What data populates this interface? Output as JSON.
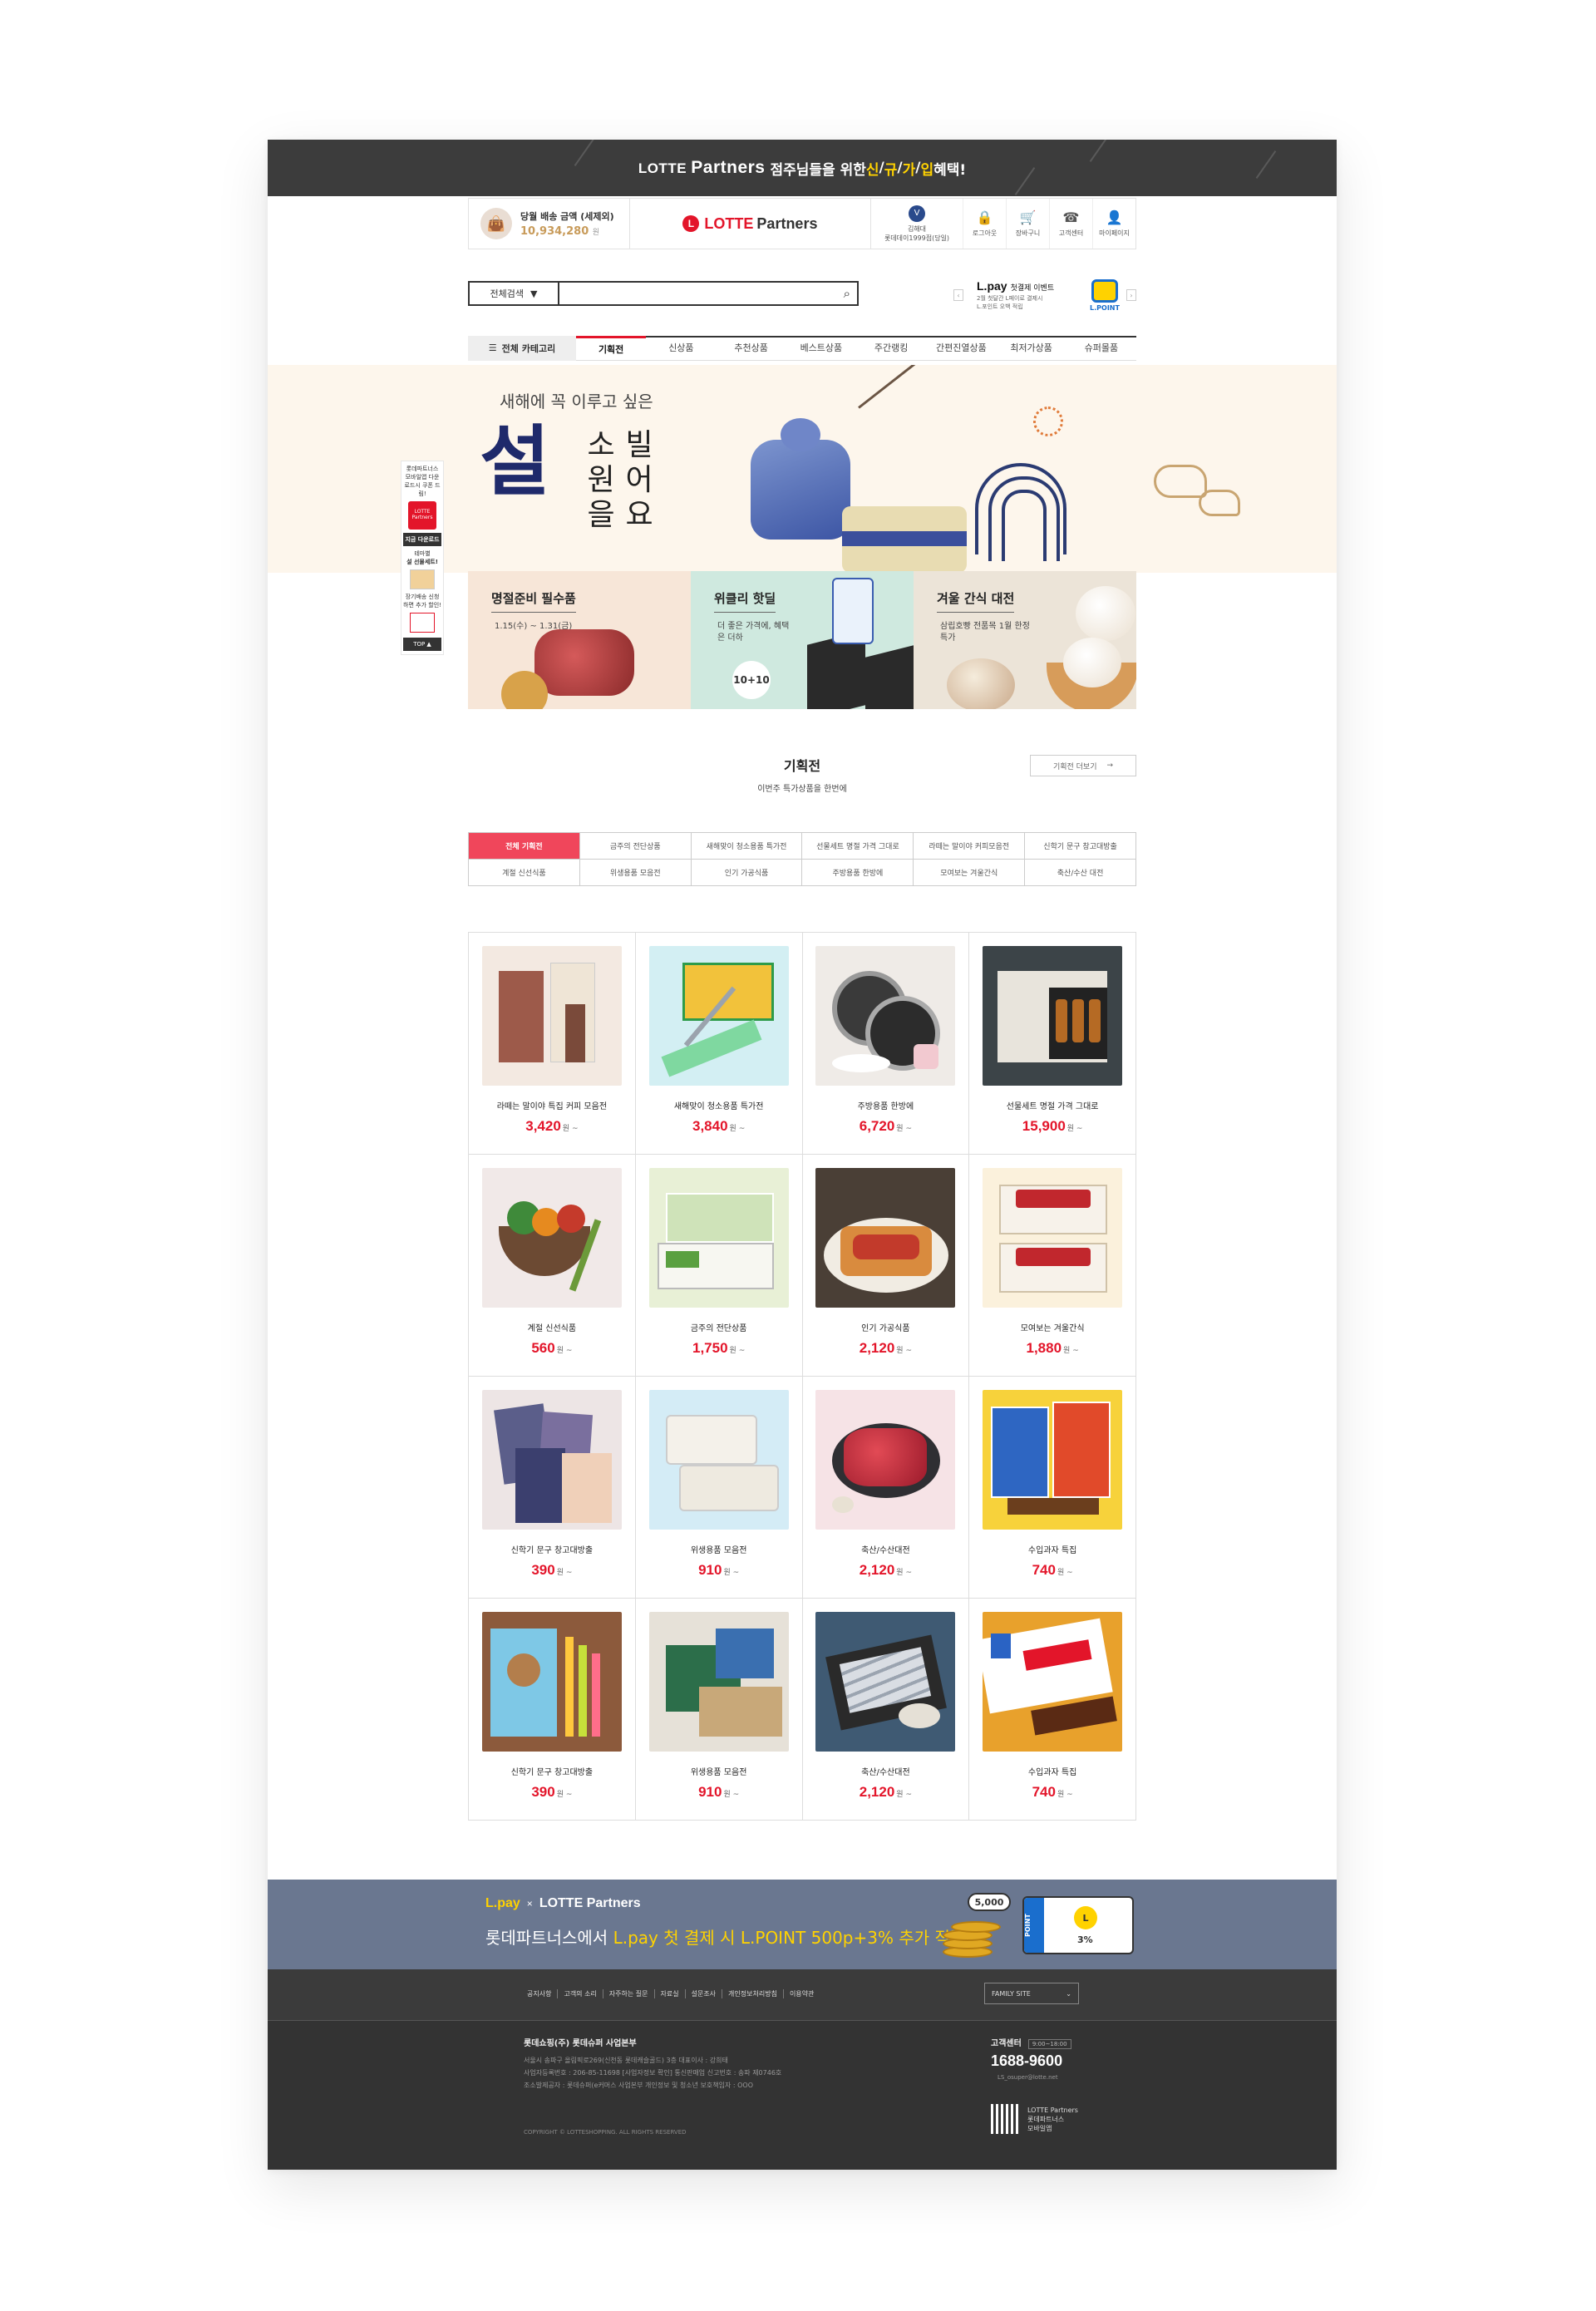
{
  "top_banner": {
    "brand_a": "LOTTE",
    "brand_b": "Partners",
    "text_a": " 점주님들을 위한 ",
    "hl1": "신",
    "sep1": "/",
    "hl2": "규",
    "sep2": "/",
    "hl3": "가",
    "sep3": "/",
    "hl4": "입",
    "text_b": " 혜택!"
  },
  "header": {
    "amount_label": "당월 배송 금액 (세제외)",
    "amount_value": "10,934,280",
    "amount_unit": "원",
    "logo_lotte": "LOTTE",
    "logo_partners": "Partners",
    "user_badge": "V",
    "user_name": "김해대",
    "user_store": "롯데데이1999점(당일)",
    "util": [
      {
        "icon": "lock-icon",
        "glyph": "🔒",
        "label": "로그아웃"
      },
      {
        "icon": "cart-icon",
        "glyph": "🛒",
        "label": "장바구니"
      },
      {
        "icon": "headset-icon",
        "glyph": "☎",
        "label": "고객센터"
      },
      {
        "icon": "person-icon",
        "glyph": "👤",
        "label": "마이페이지"
      }
    ]
  },
  "search": {
    "category": "전체검색",
    "category_arrow": "▼",
    "placeholder": "",
    "icon": "search-icon"
  },
  "lpay_event": {
    "title": "L.pay",
    "subtitle": "첫결제 이벤트",
    "desc": "2월 첫달간 L페이로 결제시 L.포인트 오백 적립",
    "point_label": "L.POINT",
    "prev": "‹",
    "next": "›"
  },
  "gnb": {
    "all_label": "전체 카테고리",
    "all_icon": "☰",
    "items": [
      "기획전",
      "신상품",
      "추천상품",
      "베스트상품",
      "주간랭킹",
      "간편진열상품",
      "최저가상품",
      "슈퍼몰품"
    ]
  },
  "hero": {
    "subtitle": "새해에 꼭 이루고 싶은",
    "big": "설",
    "col1": [
      "소",
      "원",
      "을"
    ],
    "col2": [
      "빌",
      "어",
      "요"
    ]
  },
  "promos": [
    {
      "title": "명절준비 필수품",
      "desc": "1.15(수) ~ 1.31(금)"
    },
    {
      "title": "위클리 핫딜",
      "desc": "더 좋은 가격에, 혜택은 더하",
      "badge": "10+10"
    },
    {
      "title": "겨울 간식 대전",
      "desc": "삼립호빵 전품목 1월 한정 특가"
    }
  ],
  "side_menu": {
    "t1": "롯데파트너스 모바일앱 다운로드시 쿠폰 드림!",
    "logo": "LOTTE Partners",
    "t2": "지금 다운로드",
    "t3": "테마별",
    "t4": "설 선물세트!",
    "t5": "장기배송 신청하면 추가 할인!",
    "top": "TOP ▲"
  },
  "section": {
    "title": "기획전",
    "subtitle": "이번주 특가상품을 한번에",
    "more": "기획전 더보기",
    "more_icon": "→"
  },
  "tabs": [
    "전체 기획전",
    "금주의 전단상품",
    "새해맞이 청소용품 특가전",
    "선물세트 명절 가격 그대로",
    "라떼는 말이야 커피모음전",
    "신학기 문구 창고대방출",
    "계절 신선식품",
    "위생용품 모음전",
    "인기 가공식품",
    "주방용품 한방에",
    "모여보는 겨울간식",
    "축산/수산 대전"
  ],
  "products": [
    {
      "name": "라떼는 말이야 특집 커피 모음전",
      "price": "3,420",
      "unit": "원 ~"
    },
    {
      "name": "새해맞이 청소용품 특가전",
      "price": "3,840",
      "unit": "원 ~"
    },
    {
      "name": "주방용품 한방에",
      "price": "6,720",
      "unit": "원 ~"
    },
    {
      "name": "선물세트 명절 가격 그대로",
      "price": "15,900",
      "unit": "원 ~"
    },
    {
      "name": "계절 신선식품",
      "price": "560",
      "unit": "원 ~"
    },
    {
      "name": "금주의 전단상품",
      "price": "1,750",
      "unit": "원 ~"
    },
    {
      "name": "인기 가공식품",
      "price": "2,120",
      "unit": "원 ~"
    },
    {
      "name": "모여보는 겨울간식",
      "price": "1,880",
      "unit": "원 ~"
    },
    {
      "name": "신학기 문구 창고대방출",
      "price": "390",
      "unit": "원 ~"
    },
    {
      "name": "위생용품 모음전",
      "price": "910",
      "unit": "원 ~"
    },
    {
      "name": "축산/수산대전",
      "price": "2,120",
      "unit": "원 ~"
    },
    {
      "name": "수입과자 특집",
      "price": "740",
      "unit": "원 ~"
    },
    {
      "name": "신학기 문구 창고대방출",
      "price": "390",
      "unit": "원 ~"
    },
    {
      "name": "위생용품 모음전",
      "price": "910",
      "unit": "원 ~"
    },
    {
      "name": "축산/수산대전",
      "price": "2,120",
      "unit": "원 ~"
    },
    {
      "name": "수입과자 특집",
      "price": "740",
      "unit": "원 ~"
    }
  ],
  "lpay_band": {
    "lpay": "L.pay",
    "x": "×",
    "brand": "LOTTE Partners",
    "msg_a": "롯데파트너스에서 ",
    "msg_b": "L.pay 첫 결제 시  L.POINT 500p+3% 추가 적립",
    "bubble": "5,000",
    "card_side": "POINT",
    "card_coin": "L",
    "card_pct": "3%"
  },
  "footer_links": [
    "공지사항",
    "고객의 소리",
    "자주하는 질문",
    "자료실",
    "설문조사",
    "개인정보처리방침",
    "이용약관"
  ],
  "family_site": "FAMILY SITE",
  "family_arrow": "⌄",
  "footer": {
    "company": "롯데쇼핑(주) 롯데슈퍼 사업본부",
    "addr": [
      "서울시 송파구 올림픽로269(신천동 롯데캐슬골드) 3층    대표이사 : 강희태",
      "사업자등록번호 : 206-85-11698 [사업자정보 확인]    통신판매업 신고번호 : 송파 제0746호",
      "조소발제공자 : 롯데슈퍼(e커머스 사업본부    개인정보 및 청소년 보호책임자 : OOO"
    ],
    "copyright": "COPYRIGHT © LOTTESHOPPING. ALL RIGHTS RESERVED",
    "cc_label": "고객센터",
    "cc_hours": "9:00~18:00",
    "phone": "1688-9600",
    "email": "LS_osuper@lotte.net",
    "app_text": [
      "LOTTE Partners",
      "롯데파트너스",
      "모바일앱"
    ]
  }
}
